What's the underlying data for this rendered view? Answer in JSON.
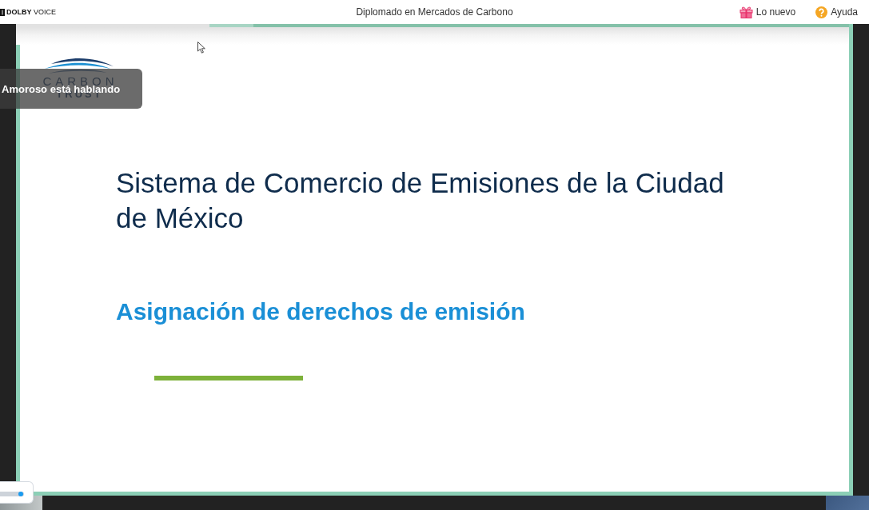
{
  "top_bar": {
    "brand": "**DOLBY** VOICE",
    "title": "Diplomado en Mercados de Carbono",
    "links": [
      {
        "kind": "gift",
        "label": "Lo nuevo"
      },
      {
        "kind": "help",
        "label": "Ayuda"
      }
    ]
  },
  "slide": {
    "logo": [
      "CARBON",
      "TRUST"
    ],
    "title": "Sistema de Comercio de Emisiones de la Ciudad de México",
    "subtitle": "Asignación de derechos de emisión"
  },
  "speaker_notice": "Amoroso está hablando",
  "slider": {
    "level": 0.86
  }
}
